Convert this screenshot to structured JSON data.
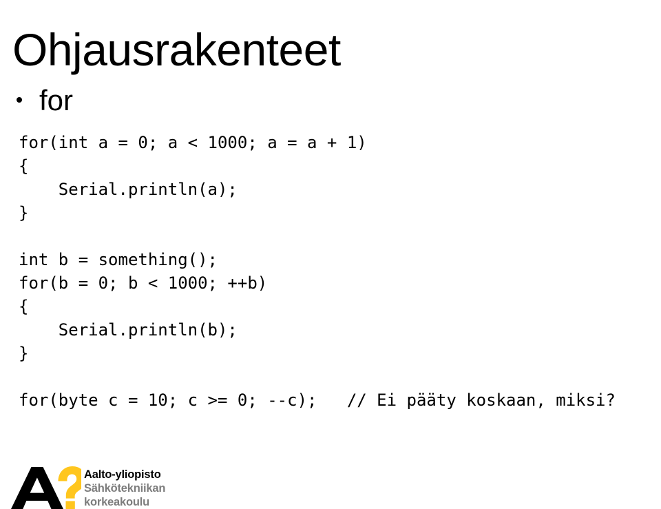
{
  "slide": {
    "title": "Ohjausrakenteet",
    "background_color": "#ffffff",
    "text_color": "#000000"
  },
  "bullets": [
    {
      "label": "for"
    }
  ],
  "code": {
    "language": "arduino-c",
    "lines": [
      "for(int a = 0; a < 1000; a = a + 1)",
      "{",
      "    Serial.println(a);",
      "}",
      "",
      "int b = something();",
      "for(b = 0; b < 1000; ++b)",
      "{",
      "    Serial.println(b);",
      "}",
      "",
      "for(byte c = 10; c >= 0; --c);   // Ei pääty koskaan, miksi?"
    ]
  },
  "logo": {
    "mark_letter": "A",
    "mark_symbol": "?",
    "mark_letter_color": "#000000",
    "mark_symbol_color": "#ffc61e",
    "line_1": "Aalto-yliopisto",
    "line_2": "Sähkötekniikan",
    "line_3": "korkeakoulu",
    "line_1_color": "#000000",
    "line_2_color": "#7d7d7d"
  }
}
